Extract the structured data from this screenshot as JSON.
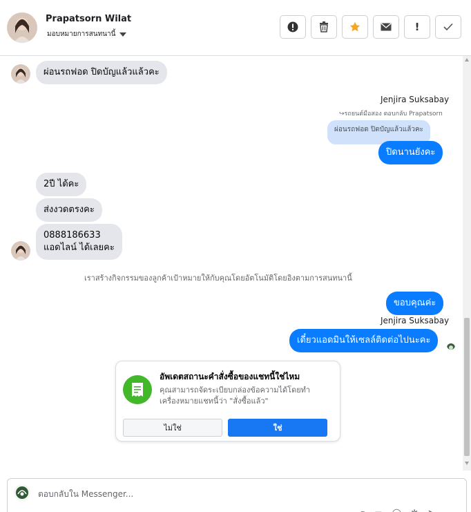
{
  "header": {
    "contact_name": "Prapatsorn Wilat",
    "assign_label": "มอบหมายการสนทนานี้",
    "toolbar": [
      {
        "icon": "spam-icon",
        "glyph": "!"
      },
      {
        "icon": "trash-icon",
        "glyph": "🗑"
      },
      {
        "icon": "star-icon",
        "glyph": "★"
      },
      {
        "icon": "envelope-icon",
        "glyph": "✉"
      },
      {
        "icon": "exclamation-icon",
        "glyph": "!"
      },
      {
        "icon": "check-icon",
        "glyph": "✓"
      }
    ]
  },
  "messages": {
    "m1": "ผ่อนรถฟอด ปิดบัญแล้วแล้วคะ",
    "sender1": "Jenjira Suksabay",
    "reply_note": "↪รถยนต์มือสอง ตอบกลับ Prapatsorn",
    "quoted": "ผ่อนรถฟอด ปิดบัญแล้วแล้วคะ",
    "m2": "ปิดนานยังคะ",
    "m3": "2ปี ได้คะ",
    "m4": "ส่งงวดตรงคะ",
    "m5_line1": "0888186633",
    "m5_line2": "แอดไลน์ ได้เลยคะ",
    "system_note": "เราสร้างกิจกรรมของลูกค้าเป้าหมายให้กับคุณโดยอัตโนมัติโดยอิงตามการสนทนานี้",
    "m6": "ขอบคุณค่ะ",
    "sender2": "Jenjira Suksabay",
    "m7": "เดี๋ยวแอดมินให้เซลล์ติดต่อไปนะคะ"
  },
  "card": {
    "title": "อัพเดตสถานะคำสั่งซื้อของแชทนี้ใช่ไหม",
    "body": "คุณสามารถจัดระเบียบกล่องข้อความได้โดยทำเครื่องหมายแชทนี้ว่า \"สั่งซื้อแล้ว\"",
    "no_label": "ไม่ใช่",
    "yes_label": "ใช่"
  },
  "composer": {
    "placeholder": "ตอบกลับใน Messenger..."
  },
  "colors": {
    "outgoing": "#0a7cff",
    "incoming": "#e4e6eb",
    "primary_button": "#1877f2",
    "card_icon": "#42b72a",
    "star": "#f5a623"
  }
}
